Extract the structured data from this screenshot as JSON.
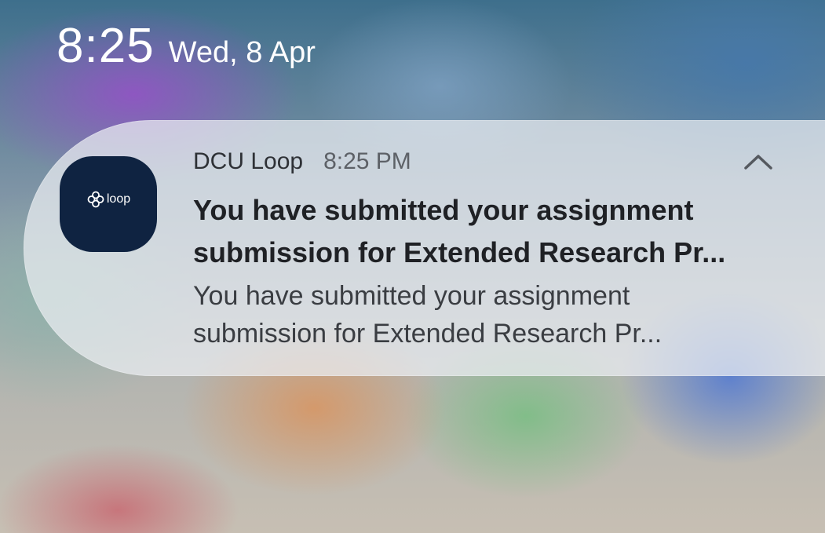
{
  "lock_screen": {
    "time": "8:25",
    "date": "Wed, 8 Apr"
  },
  "notification": {
    "app_name": "DCU Loop",
    "app_icon": "loop-logo",
    "app_icon_text": "loop",
    "time": "8:25 PM",
    "collapse_icon": "chevron-up-icon",
    "title_lines": [
      "You have submitted your assignment",
      "submission for Extended Research Pr..."
    ],
    "body_lines": [
      "You have submitted your assignment",
      "submission for Extended Research Pr..."
    ]
  },
  "colors": {
    "icon_background": "#0f2341",
    "card_background": "#eceef2",
    "clock_text": "#ffffff"
  }
}
